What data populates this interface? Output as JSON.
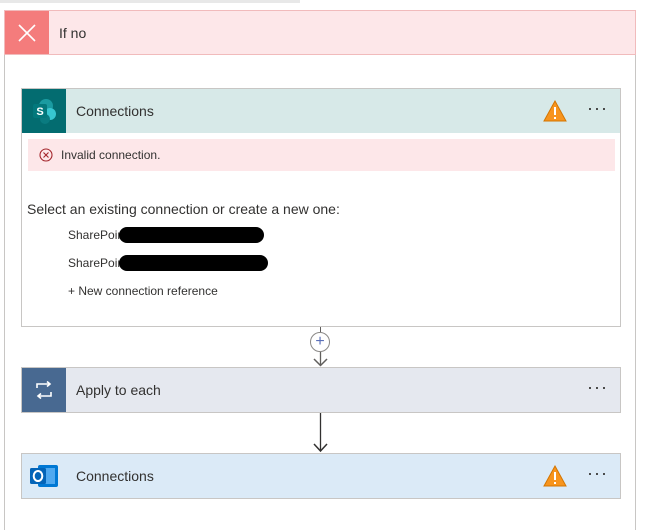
{
  "condition_branch": {
    "title": "If no",
    "icon": "close-x-icon",
    "accent_color": "#f47c7c",
    "background_color": "#fde7e9"
  },
  "sharepoint_action": {
    "title": "Connections",
    "icon": "sharepoint-icon",
    "status_icon": "warning-icon",
    "more_label": "···",
    "error_text": "Invalid connection.",
    "select_label": "Select an existing connection or create a new one:",
    "connections": [
      {
        "label": "SharePoint"
      },
      {
        "label": "SharePoint"
      }
    ],
    "new_connection_label": "+ New connection reference"
  },
  "insert_step": {
    "label": "+",
    "icon": "plus-icon"
  },
  "apply_to_each": {
    "title": "Apply to each",
    "icon": "loop-icon",
    "more_label": "···"
  },
  "outlook_action": {
    "title": "Connections",
    "icon": "outlook-icon",
    "status_icon": "warning-icon",
    "more_label": "···"
  }
}
